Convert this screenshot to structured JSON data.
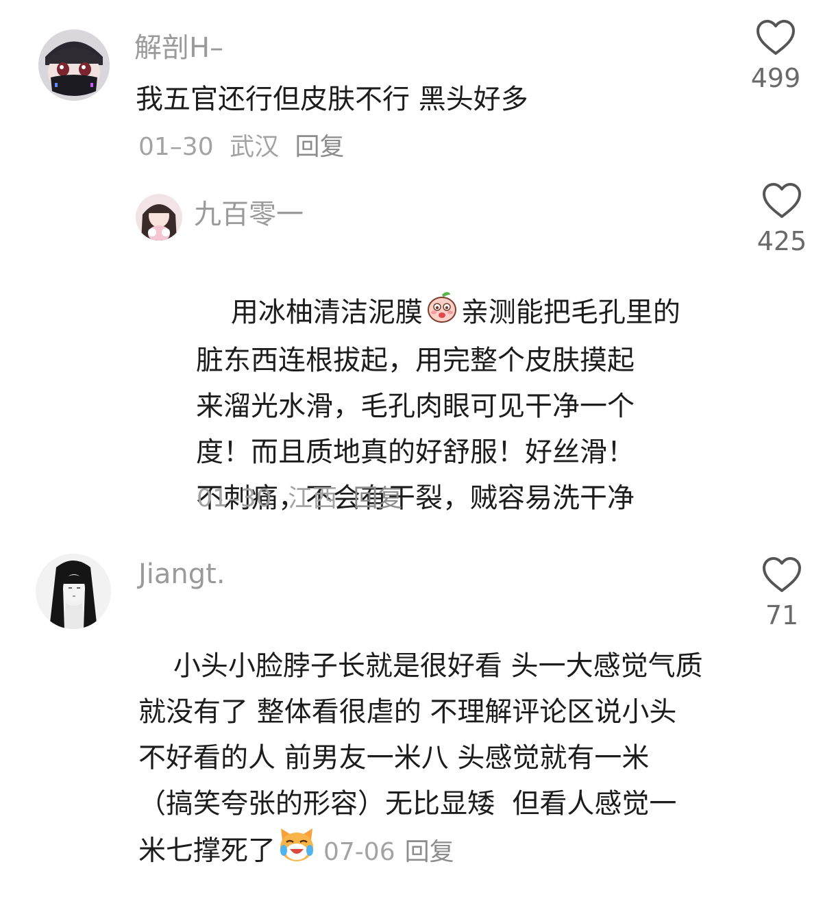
{
  "comments": [
    {
      "username": "解剖H–",
      "text": "我五官还行但皮肤不行 黑头好多",
      "date": "01–30",
      "location": "武汉",
      "reply_label": "回复",
      "likes": "499",
      "avatar_icon": "masked-avatar"
    },
    {
      "username": "九百零一",
      "text_line1_a": "用冰柚清洁泥膜",
      "text_line1_b": "亲测能把毛孔里的",
      "text_rest": "脏东西连根拔起，用完整个皮肤摸起\n来溜光水滑，毛孔肉眼可见干净一个\n度！而且质地真的好舒服！好丝滑！\n不刺痛，不会有干裂，贼容易洗干净",
      "emoji_icon": "peach-shy-emoji",
      "date": "01–30",
      "location": "江西",
      "reply_label": "回复",
      "likes": "425",
      "avatar_icon": "girl-photo-avatar"
    },
    {
      "username": "Jiangt.",
      "text_main": "小头小脸脖子长就是很好看 头一大感觉气质\n就没有了 整体看很虐的 不理解评论区说小头\n不好看的人 前男友一米八 头感觉就有一米\n（搞笑夸张的形容）无比显矮  但看人感觉一\n",
      "text_last": "米七撑死了",
      "emoji_icon": "laughing-cat-emoji",
      "date": "07-06",
      "reply_label": "回复",
      "likes": "71",
      "avatar_icon": "sketch-girl-avatar"
    }
  ],
  "colors": {
    "username": "#9a9a9a",
    "text": "#1c1c1c",
    "meta": "#a3a3a3",
    "like_icon": "#555555"
  }
}
